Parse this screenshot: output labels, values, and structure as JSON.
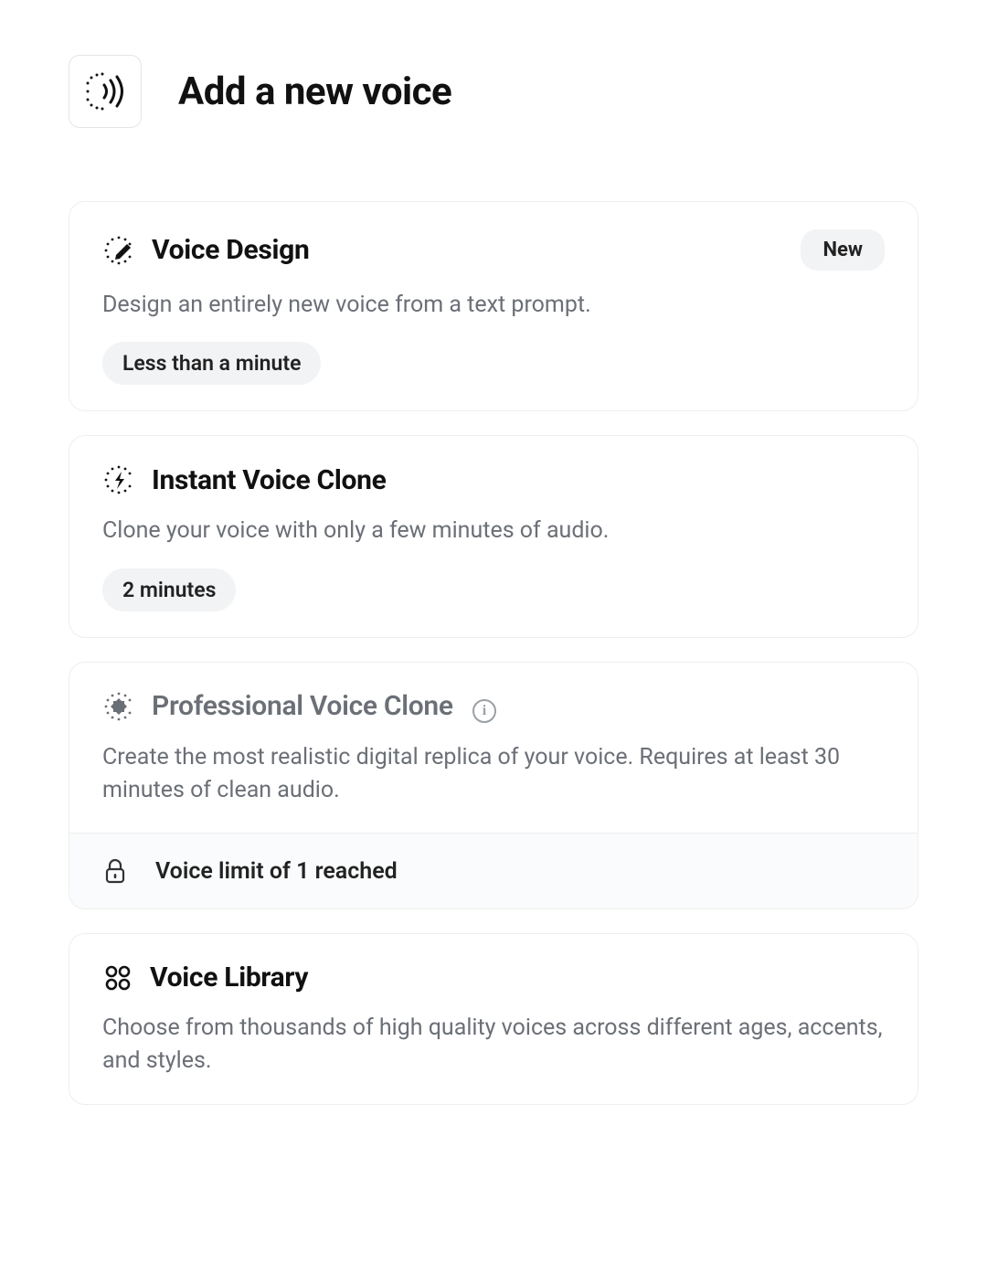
{
  "header": {
    "title": "Add a new voice"
  },
  "cards": {
    "voice_design": {
      "title": "Voice Design",
      "badge": "New",
      "desc": "Design an entirely new voice from a text prompt.",
      "time": "Less than a minute"
    },
    "instant_clone": {
      "title": "Instant Voice Clone",
      "desc": "Clone your voice with only a few minutes of audio.",
      "time": "2 minutes"
    },
    "pro_clone": {
      "title": "Professional Voice Clone",
      "desc": "Create the most realistic digital replica of your voice. Requires at least 30 minutes of clean audio.",
      "limit_msg": "Voice limit of 1 reached"
    },
    "library": {
      "title": "Voice Library",
      "desc": "Choose from thousands of high quality voices across different ages, accents, and styles."
    }
  }
}
